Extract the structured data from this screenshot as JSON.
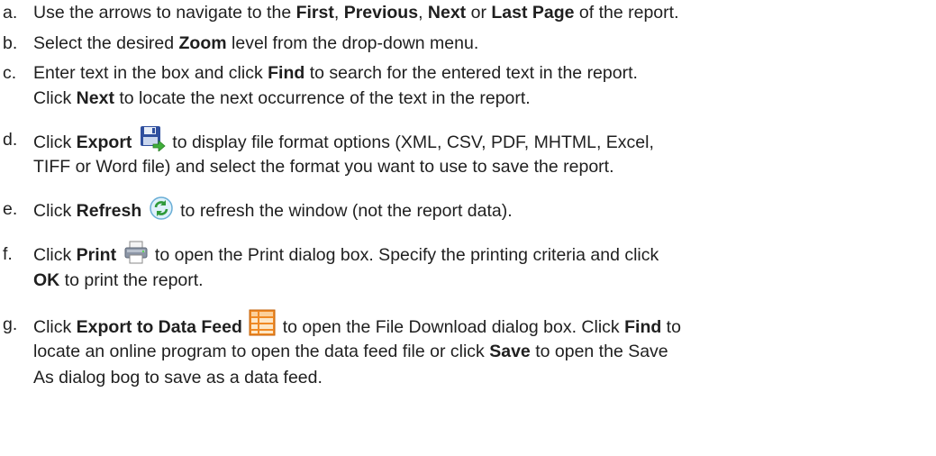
{
  "items": [
    {
      "marker": "a.",
      "lines": [
        [
          {
            "t": "Use the arrows to navigate to the "
          },
          {
            "t": "First",
            "b": true
          },
          {
            "t": ", "
          },
          {
            "t": "Previous",
            "b": true
          },
          {
            "t": ", "
          },
          {
            "t": "Next",
            "b": true
          },
          {
            "t": " or "
          },
          {
            "t": "Last Page",
            "b": true
          },
          {
            "t": " of the report."
          }
        ]
      ]
    },
    {
      "marker": "b.",
      "lines": [
        [
          {
            "t": "Select the desired "
          },
          {
            "t": "Zoom",
            "b": true
          },
          {
            "t": " level from the drop-down menu."
          }
        ]
      ]
    },
    {
      "marker": "c.",
      "lines": [
        [
          {
            "t": "Enter text in the box and click "
          },
          {
            "t": "Find",
            "b": true
          },
          {
            "t": " to search for the entered text in the report."
          }
        ],
        [
          {
            "t": "Click "
          },
          {
            "t": "Next",
            "b": true
          },
          {
            "t": " to locate the next occurrence of the text in the report."
          }
        ]
      ]
    },
    {
      "marker": "d.",
      "lines": [
        [
          {
            "t": "Click "
          },
          {
            "t": "Export",
            "b": true
          },
          {
            "t": " "
          },
          {
            "icon": "save-export-icon"
          },
          {
            "t": " to display file format options (XML, CSV, PDF, MHTML, Excel,"
          }
        ],
        [
          {
            "t": "TIFF or Word file) and select the format you want to use to save the report."
          }
        ]
      ]
    },
    {
      "marker": "e.",
      "lines": [
        [
          {
            "t": "Click "
          },
          {
            "t": "Refresh",
            "b": true
          },
          {
            "t": " "
          },
          {
            "icon": "refresh-icon"
          },
          {
            "t": " to refresh the window (not the report data)."
          }
        ]
      ]
    },
    {
      "marker": "f.",
      "lines": [
        [
          {
            "t": "Click "
          },
          {
            "t": "Print",
            "b": true
          },
          {
            "t": " "
          },
          {
            "icon": "printer-icon"
          },
          {
            "t": " to open the Print dialog box. Specify the printing criteria and click"
          }
        ],
        [
          {
            "t": "OK",
            "b": true
          },
          {
            "t": " to print the report."
          }
        ]
      ]
    },
    {
      "marker": "g.",
      "lines": [
        [
          {
            "t": "Click "
          },
          {
            "t": "Export to Data Feed",
            "b": true
          },
          {
            "t": " "
          },
          {
            "icon": "data-feed-icon"
          },
          {
            "t": " to open the File Download dialog box. Click "
          },
          {
            "t": "Find",
            "b": true
          },
          {
            "t": " to"
          }
        ],
        [
          {
            "t": "locate an online program to open the data feed file or click "
          },
          {
            "t": "Save",
            "b": true
          },
          {
            "t": " to open the Save"
          }
        ],
        [
          {
            "t": "As dialog bog to save as a data feed."
          }
        ]
      ]
    }
  ]
}
